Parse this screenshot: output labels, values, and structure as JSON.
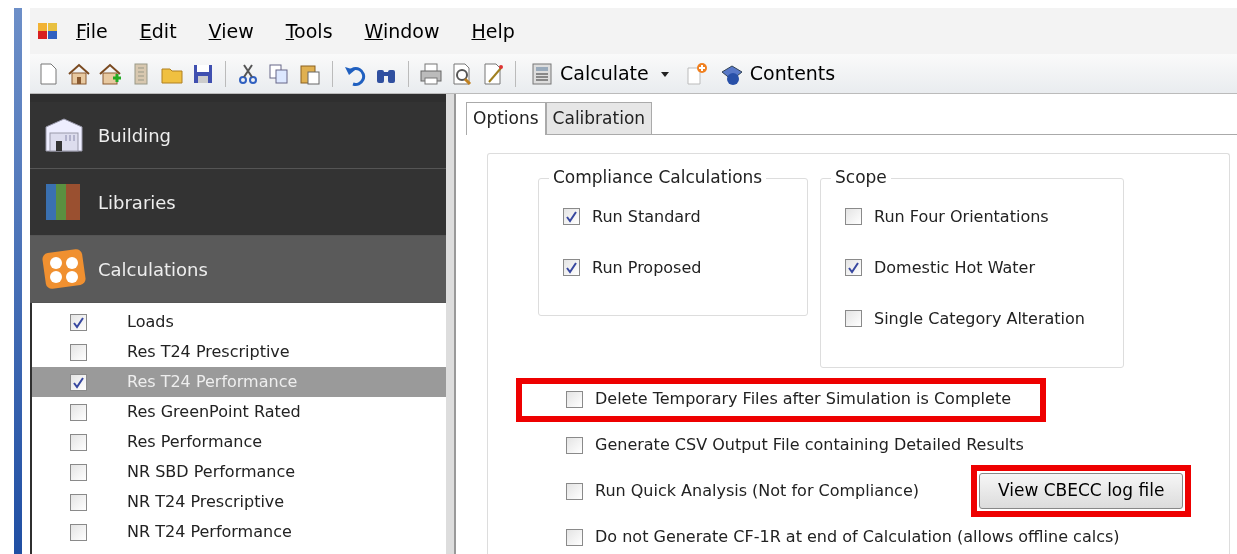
{
  "menu": [
    "File",
    "Edit",
    "View",
    "Tools",
    "Window",
    "Help"
  ],
  "toolbar": {
    "calculate": {
      "label": "Calculate",
      "dropdown": true
    },
    "contents": {
      "label": "Contents"
    }
  },
  "sidebar": {
    "sections": [
      {
        "label": "Building",
        "selected": false
      },
      {
        "label": "Libraries",
        "selected": false
      },
      {
        "label": "Calculations",
        "selected": true
      }
    ],
    "items": [
      {
        "label": "Loads",
        "checked": true,
        "selected": false
      },
      {
        "label": "Res T24 Prescriptive",
        "checked": false,
        "selected": false
      },
      {
        "label": "Res T24 Performance",
        "checked": true,
        "selected": true
      },
      {
        "label": "Res GreenPoint Rated",
        "checked": false,
        "selected": false
      },
      {
        "label": "Res Performance",
        "checked": false,
        "selected": false
      },
      {
        "label": "NR SBD Performance",
        "checked": false,
        "selected": false
      },
      {
        "label": "NR T24 Prescriptive",
        "checked": false,
        "selected": false
      },
      {
        "label": "NR T24 Performance",
        "checked": false,
        "selected": false
      }
    ]
  },
  "tabs": [
    {
      "label": "Options",
      "selected": true
    },
    {
      "label": "Calibration",
      "selected": false
    }
  ],
  "groups": [
    {
      "title": "Compliance Calculations",
      "options": [
        {
          "label": "Run Standard",
          "checked": true
        },
        {
          "label": "Run Proposed",
          "checked": true
        }
      ]
    },
    {
      "title": "Scope",
      "options": [
        {
          "label": "Run Four Orientations",
          "checked": false
        },
        {
          "label": "Domestic Hot Water",
          "checked": true
        },
        {
          "label": "Single Category Alteration",
          "checked": false
        }
      ]
    }
  ],
  "options": [
    {
      "label": "Delete Temporary Files after Simulation is Complete",
      "checked": false,
      "highlighted": true
    },
    {
      "label": "Generate CSV Output File containing Detailed Results",
      "checked": false,
      "highlighted": false
    },
    {
      "label": "Run Quick Analysis (Not for Compliance)",
      "checked": false,
      "highlighted": false
    },
    {
      "label": "Do not Generate CF-1R at end of Calculation (allows offline calcs)",
      "checked": false,
      "highlighted": false
    }
  ],
  "log_button": {
    "label": "View CBECC log file",
    "highlighted": true
  }
}
